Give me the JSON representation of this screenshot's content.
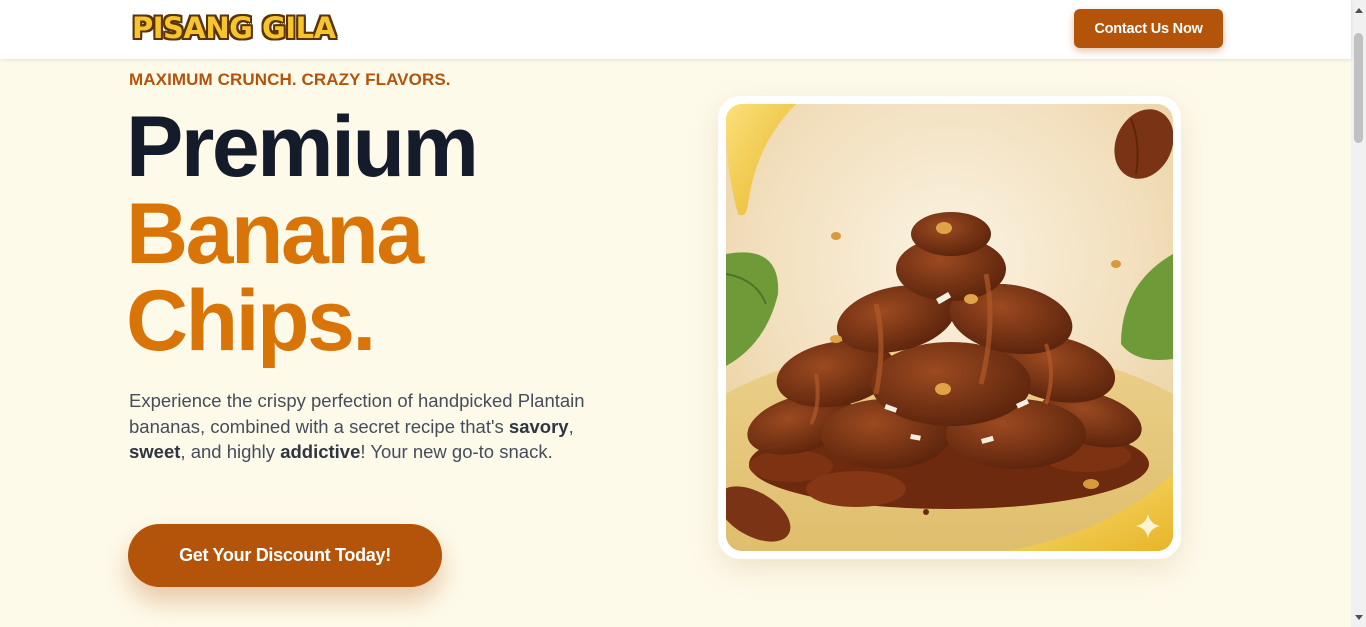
{
  "header": {
    "logo_text": "PISANG GILA",
    "contact_label": "Contact Us Now"
  },
  "hero": {
    "eyebrow": "MAXIMUM CRUNCH. CRAZY FLAVORS.",
    "headline_line1": "Premium",
    "headline_line2": "Banana",
    "headline_line3": "Chips.",
    "desc_part1": "Experience the crispy perfection of handpicked Plantain bananas, combined with a secret recipe that's ",
    "desc_bold1": "savory",
    "desc_part2": ", ",
    "desc_bold2": "sweet",
    "desc_part3": ", and highly ",
    "desc_bold3": "addictive",
    "desc_part4": "! Your new go-to snack.",
    "cta_label": "Get Your Discount Today!"
  },
  "image": {
    "subject": "chocolate-drizzled banana chips pile",
    "sparkle_icon": "sparkle-icon"
  },
  "colors": {
    "brand": "#b4540a",
    "accent": "#d97508",
    "heading": "#141c2b",
    "background": "#fefaea"
  }
}
